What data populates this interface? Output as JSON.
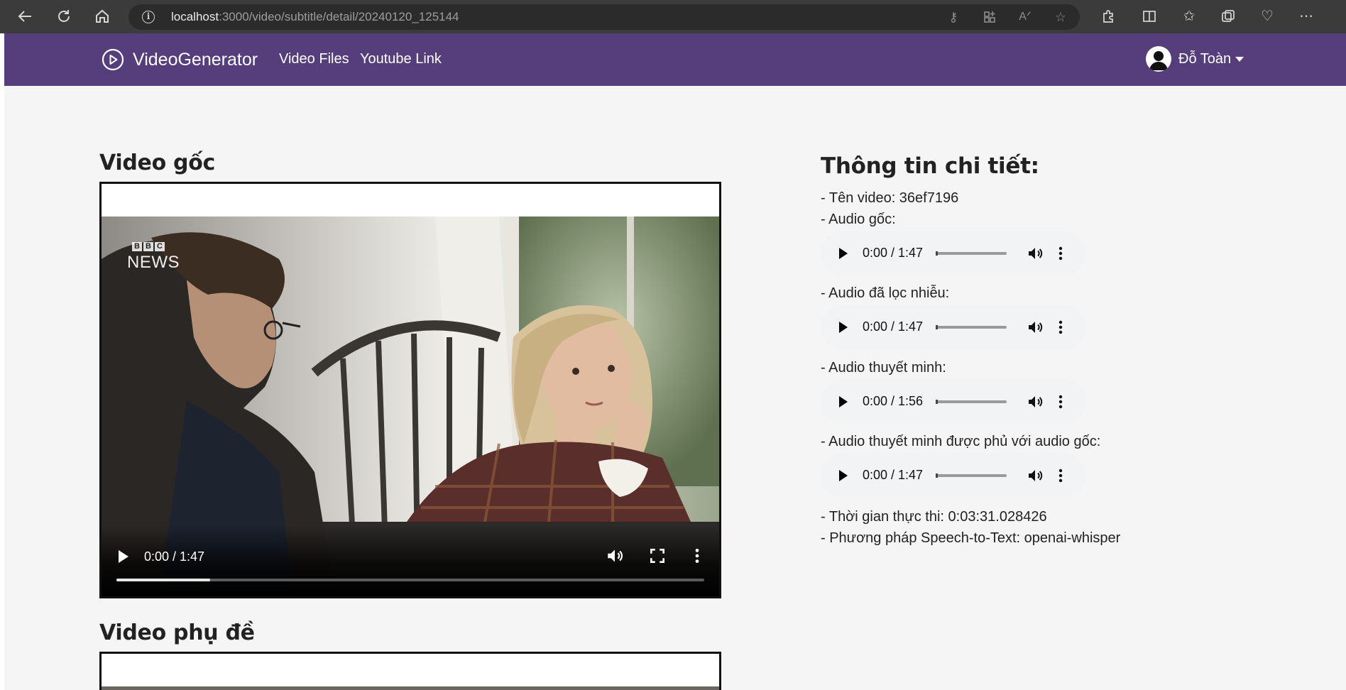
{
  "browser": {
    "url_host": "localhost",
    "url_path": ":3000/video/subtitle/detail/20240120_125144"
  },
  "navbar": {
    "brand": "VideoGenerator",
    "links": [
      "Video Files",
      "Youtube Link"
    ],
    "user_name": "Đỗ Toàn"
  },
  "original_video": {
    "title": "Video gốc",
    "time": "0:00 / 1:47",
    "progress": 0.16,
    "watermark_top": "BBC",
    "watermark_bottom": "NEWS"
  },
  "subtitle_video": {
    "title": "Video phụ đề"
  },
  "details": {
    "title": "Thông tin chi tiết:",
    "video_name": "- Tên video: 36ef7196",
    "audio_original_label": "- Audio gốc:",
    "audio_original_time": "0:00 / 1:47",
    "audio_denoised_label": "- Audio đã lọc nhiễu:",
    "audio_denoised_time": "0:00 / 1:47",
    "audio_narration_label": "- Audio thuyết minh:",
    "audio_narration_time": "0:00 / 1:56",
    "audio_mixed_label": "- Audio thuyết minh được phủ với audio gốc:",
    "audio_mixed_time": "0:00 / 1:47",
    "execution_time": "- Thời gian thực thi: 0:03:31.028426",
    "stt_method": "- Phương pháp Speech-to-Text: openai-whisper"
  }
}
